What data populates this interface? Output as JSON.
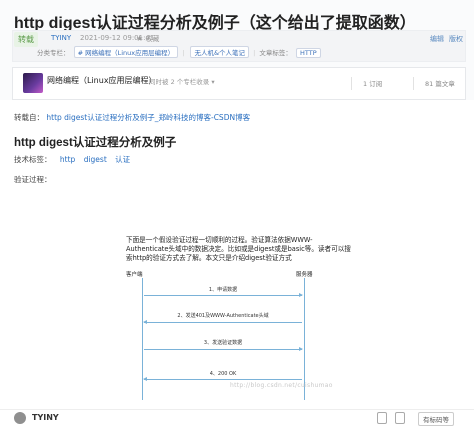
{
  "article": {
    "title": "http digest认证过程分析及例子（这个给出了提取函数）"
  },
  "meta": {
    "badge": "转载",
    "author": "TYINY",
    "time": "2021-09-12 09:01:41",
    "favorite_label": "收藏",
    "edit_label": "编辑",
    "collapse_label": "版权",
    "category_label": "分类专栏：",
    "category_tag": "# 网络编程（Linux应用层编程）",
    "course_label": "无人机&个人笔记",
    "article_tags_label": "文章标签：",
    "article_tag": "HTTP"
  },
  "column": {
    "title": "网络编程（Linux应用层编程）",
    "subtitle": "同时被 2 个专栏收录 ▾",
    "stat1": "1 订阅",
    "stat2": "81 篇文章"
  },
  "content": {
    "repost_label": "转载自：",
    "repost_link": "http digest认证过程分析及例子_郑岭科技的博客-CSDN博客",
    "heading": "http digest认证过程分析及例子",
    "tags_label": "技术标签：",
    "tag1": "http",
    "tag2": "digest",
    "tag3": "认证",
    "process_label": "验证过程："
  },
  "figure": {
    "intro": "下面是一个假设验证过程一切顺利的过程。验证算法依据WWW-Authenticate头域中的数据决定。比如或是digest或是basic等。读者可以搜索http的验证方式去了解。本文只是介绍digest验证方式",
    "client": "客户端",
    "server": "服务器",
    "steps": [
      "1、申请数据",
      "2、发送401及WWW-Authenticate头域",
      "3、发送验证数据",
      "4、200 OK"
    ],
    "watermark": "http://blog.csdn.net/cuishumao"
  },
  "footer": {
    "author": "TYINY",
    "follow_label": "有标码等"
  },
  "colors": {
    "link": "#2a6fc0",
    "lane": "#7ab2d8"
  }
}
